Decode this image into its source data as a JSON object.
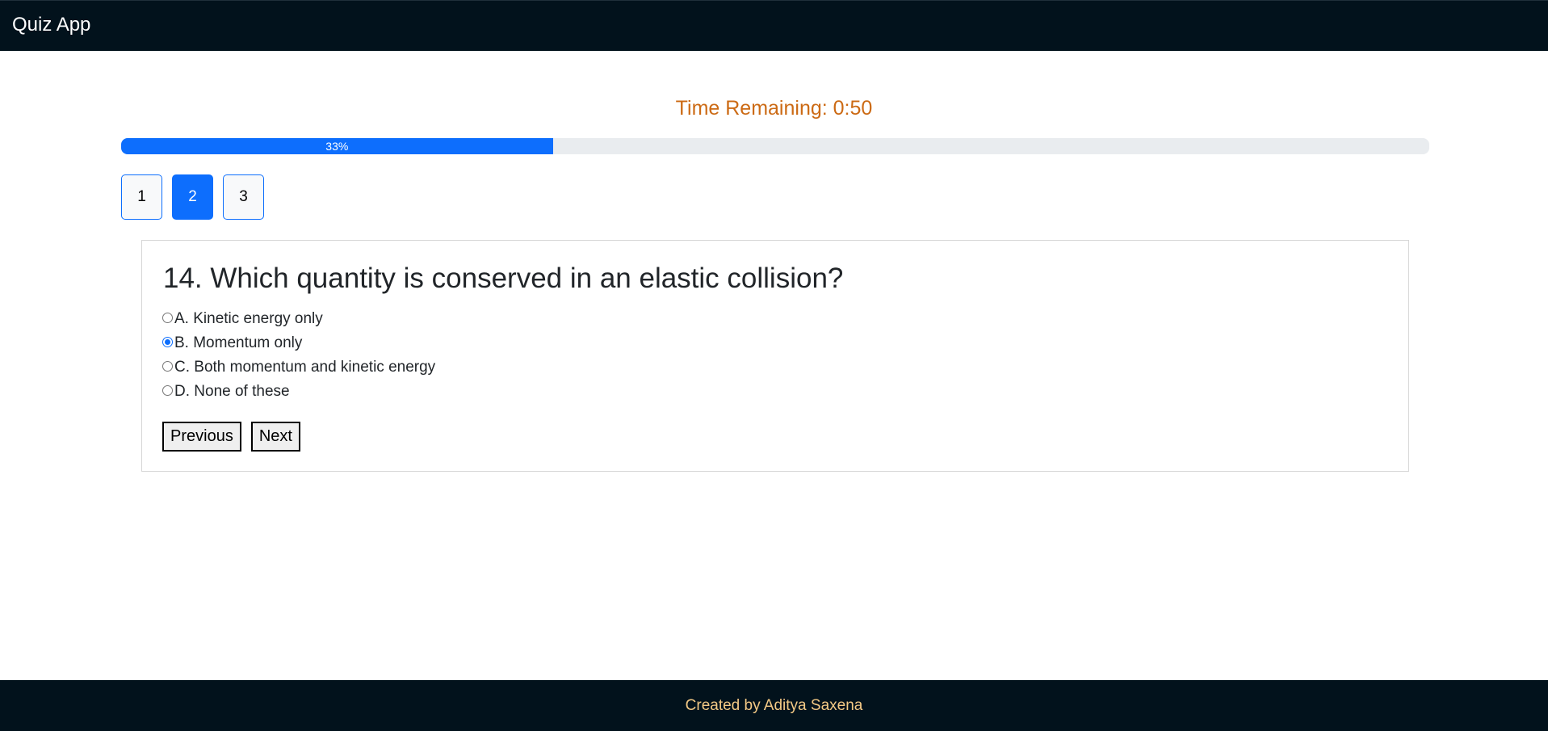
{
  "app": {
    "title": "Quiz App"
  },
  "timer": {
    "text": "Time Remaining: 0:50"
  },
  "progress": {
    "percent": 33,
    "label": "33%"
  },
  "question_nav": [
    {
      "label": "1",
      "active": false
    },
    {
      "label": "2",
      "active": true
    },
    {
      "label": "3",
      "active": false
    }
  ],
  "question": {
    "text": "14. Which quantity is conserved in an elastic collision?",
    "options": [
      {
        "label": "A. Kinetic energy only",
        "selected": false
      },
      {
        "label": "B. Momentum only",
        "selected": true
      },
      {
        "label": "C. Both momentum and kinetic energy",
        "selected": false
      },
      {
        "label": "D. None of these",
        "selected": false
      }
    ]
  },
  "actions": {
    "previous_label": "Previous",
    "next_label": "Next"
  },
  "footer": {
    "text": "Created by Aditya Saxena"
  },
  "colors": {
    "nav_bg": "#02121c",
    "accent": "#0d6efd",
    "timer": "#cc6a14",
    "footer_text": "#f3c985"
  }
}
